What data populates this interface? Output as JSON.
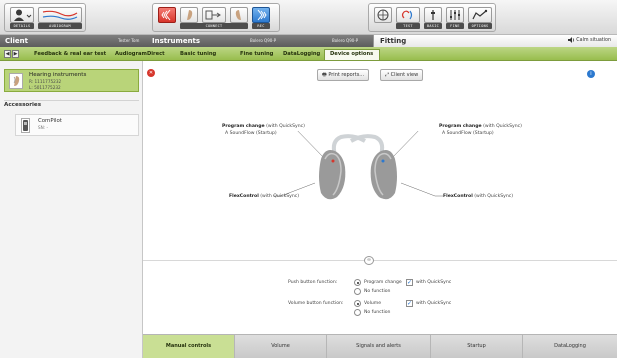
{
  "toolbar": {
    "group1": [
      "DETAILS",
      "AUDIOGRAM"
    ],
    "connect_label": "CONNECT",
    "rec_label": "REC",
    "group3": [
      "TEST",
      "BASIC",
      "FINE",
      "OPTIONS"
    ]
  },
  "sections": {
    "client": "Client",
    "client_name": "Tester Tom",
    "instruments": "Instruments",
    "instrument_left": "Bolero Q90-P",
    "instrument_right": "Bolero Q90-P",
    "fitting": "Fitting",
    "calm": "Calm situation"
  },
  "nav": {
    "items": [
      "Feedback & real ear test",
      "AudiogramDirect",
      "Basic tuning",
      "Fine tuning",
      "DataLogging",
      "Device options"
    ],
    "active": "Device options"
  },
  "left": {
    "hearing_title": "Hearing instruments",
    "serial_right": "R: 1111775232",
    "serial_left": "L: 5011775232",
    "accessories_heading": "Accessories",
    "compilot_name": "ComPilot",
    "compilot_sub": "SN: -"
  },
  "main": {
    "print_reports": "Print reports...",
    "client_view": "Client view",
    "left_prog_title": "Program change",
    "left_prog_suffix": "(with QuickSync)",
    "left_prog_sub": "A   SoundFlow (Startup)",
    "right_prog_title": "Program change",
    "right_prog_suffix": "(with QuickSync)",
    "right_prog_sub": "A   SoundFlow (Startup)",
    "left_flex_title": "FlexControl",
    "left_flex_suffix": "(with QuickSync)",
    "right_flex_title": "FlexControl",
    "right_flex_suffix": "(with QuickSync)",
    "link_icon": "link-icon"
  },
  "push": {
    "label": "Push button function:",
    "opt1": "Program change",
    "opt2": "No function",
    "check": "with QuickSync"
  },
  "volume": {
    "label": "Volume button function:",
    "opt1": "Volume",
    "opt2": "No function",
    "check": "with QuickSync"
  },
  "bottom_tabs": [
    "Manual controls",
    "Volume",
    "Signals and alerts",
    "Startup",
    "DataLogging"
  ],
  "colors": {
    "nav_green": "#a7c765",
    "active_tab_green": "#c9df94",
    "left_device": "#d6362c",
    "right_device": "#2c79cf"
  }
}
